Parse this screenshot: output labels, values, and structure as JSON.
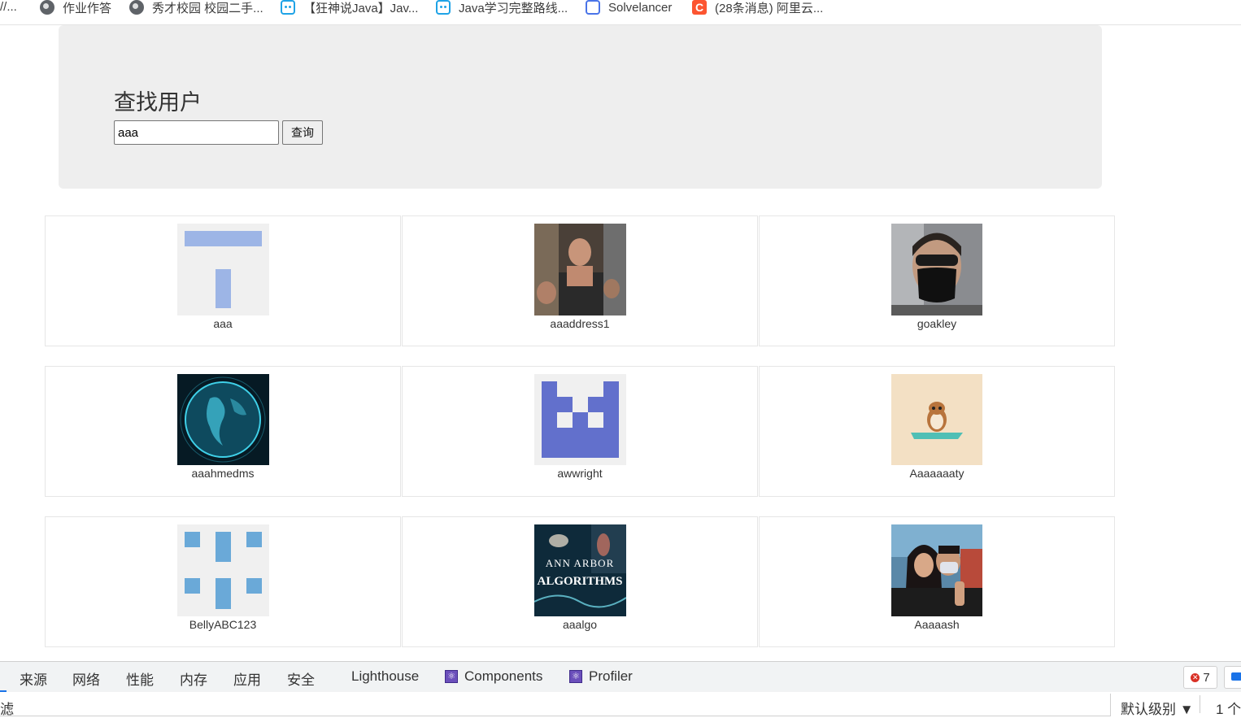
{
  "bookmarks": {
    "lead_text": "//...",
    "items": [
      {
        "label": "作业作答",
        "icon": "globe-icon"
      },
      {
        "label": "秀才校园 校园二手...",
        "icon": "globe-icon"
      },
      {
        "label": "【狂神说Java】Jav...",
        "icon": "bilibili-icon"
      },
      {
        "label": "Java学习完整路线...",
        "icon": "bilibili-icon"
      },
      {
        "label": "Solvelancer",
        "icon": "solvelancer-icon"
      },
      {
        "label": "(28条消息) 阿里云...",
        "icon": "csdn-icon"
      }
    ]
  },
  "search": {
    "title": "查找用户",
    "input_value": "aaa",
    "button_label": "查询"
  },
  "users": [
    {
      "name": "aaa",
      "avatar": "identicon-blue-t"
    },
    {
      "name": "aaaddress1",
      "avatar": "photo-man-group"
    },
    {
      "name": "goakley",
      "avatar": "photo-person-mask"
    },
    {
      "name": "aaahmedms",
      "avatar": "photo-earth-globe"
    },
    {
      "name": "awwright",
      "avatar": "identicon-purple-blocks"
    },
    {
      "name": "Aaaaaaaty",
      "avatar": "illustration-hamster-yoga"
    },
    {
      "name": "BellyABC123",
      "avatar": "identicon-blue-dots"
    },
    {
      "name": "aaalgo",
      "avatar": "logo-ann-arbor-algorithms",
      "avatar_text": [
        "ANN ARBOR",
        "ALGORITHMS"
      ]
    },
    {
      "name": "Aaaaash",
      "avatar": "photo-couple-selfie"
    }
  ],
  "devtools": {
    "tabs": [
      "来源",
      "网络",
      "性能",
      "内存",
      "应用",
      "安全",
      "Lighthouse",
      "Components",
      "Profiler"
    ],
    "error_count": "7",
    "filter_label": "滤",
    "level_label": "默认级别 ▼",
    "issues_label": "1 个"
  },
  "colors": {
    "jumbotron_bg": "#eeeeee",
    "card_border": "#e6e6e6",
    "devtools_bg": "#f1f3f4",
    "accent": "#1a73e8"
  }
}
